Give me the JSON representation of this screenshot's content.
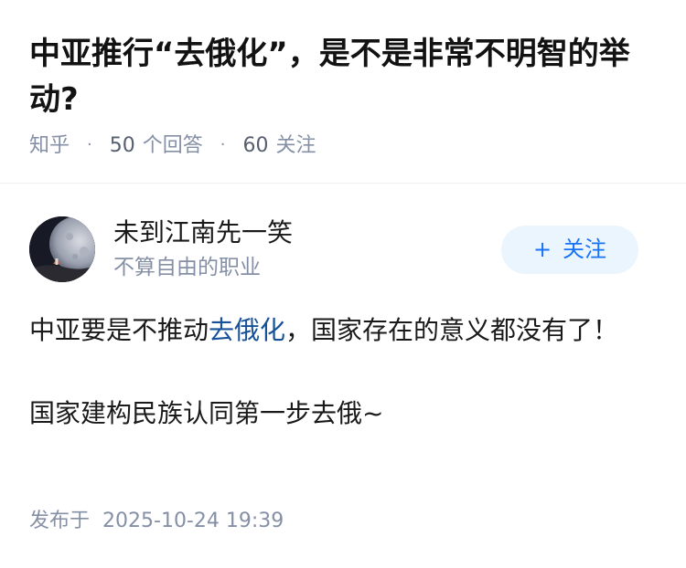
{
  "question": {
    "title": "中亚推行“去俄化”，是不是非常不明智的举动?",
    "source": "知乎",
    "answer_count": "50",
    "answer_label": "个回答",
    "follower_count": "60",
    "follower_label": "关注"
  },
  "answer": {
    "author": {
      "name": "未到江南先一笑",
      "bio": "不算自由的职业",
      "avatar_icon": "avatar-moon-figure"
    },
    "follow_button": {
      "icon": "plus-icon",
      "label": "关注"
    },
    "paragraph1": {
      "before": "中亚要是不推动",
      "link": "去俄化",
      "after": "，国家存在的意义都没有了！"
    },
    "paragraph2": "国家建构民族认同第一步去俄~",
    "published": {
      "prefix": "发布于",
      "datetime": "2025-10-24 19:39"
    }
  },
  "colors": {
    "accent": "#1772f6",
    "link": "#175199",
    "meta": "#8590a6",
    "follow_bg": "#ebf5fd"
  }
}
